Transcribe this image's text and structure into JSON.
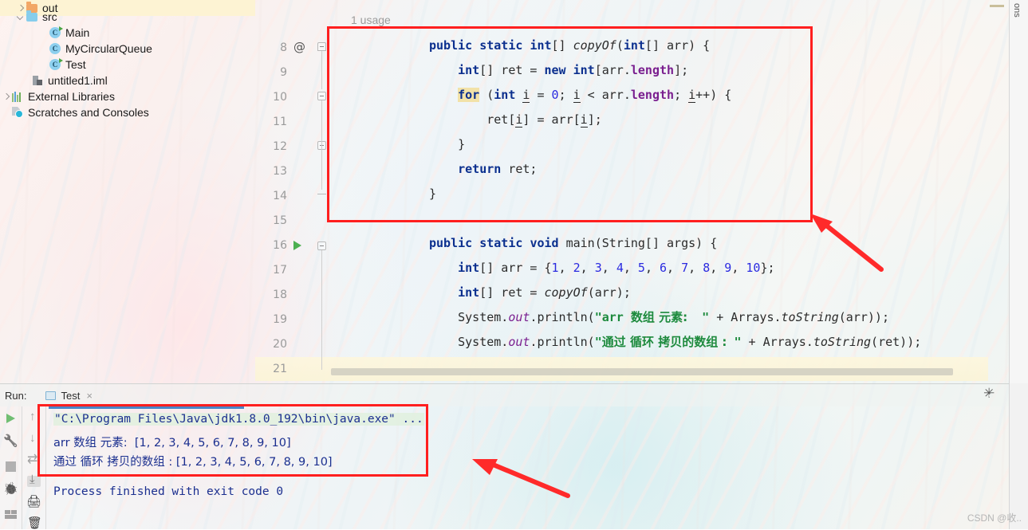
{
  "app": {
    "ide": "IntelliJ IDEA",
    "accent_red": "#ff1f1f",
    "watermark": "CSDN @收.."
  },
  "project_tree": {
    "items": [
      {
        "label": "out",
        "icon": "folder-orange-icon",
        "indent": 38,
        "arrow": "right",
        "selected": true
      },
      {
        "label": "src",
        "icon": "folder-blue-icon",
        "indent": 38,
        "arrow": "down",
        "selected": false
      },
      {
        "label": "Main",
        "icon": "class-runnable-icon",
        "indent": 62,
        "arrow": "none",
        "selected": false
      },
      {
        "label": "MyCircularQueue",
        "icon": "class-icon",
        "indent": 62,
        "arrow": "none",
        "selected": false
      },
      {
        "label": "Test",
        "icon": "class-runnable-icon",
        "indent": 62,
        "arrow": "none",
        "selected": false
      },
      {
        "label": "untitled1.iml",
        "icon": "iml-file-icon",
        "indent": 38,
        "arrow": "none",
        "selected": false
      },
      {
        "label": "External Libraries",
        "icon": "libraries-icon",
        "indent": 16,
        "arrow": "right",
        "selected": false
      },
      {
        "label": "Scratches and Consoles",
        "icon": "scratches-icon",
        "indent": 16,
        "arrow": "none",
        "selected": false
      }
    ]
  },
  "editor": {
    "usage_hint": "1 usage",
    "line_numbers": [
      "8",
      "9",
      "10",
      "11",
      "12",
      "13",
      "14",
      "15",
      "16",
      "17",
      "18",
      "19",
      "20",
      "21"
    ],
    "annotation_marker": "@",
    "current_line": "21",
    "code_lines": [
      {
        "n": "8",
        "text": "public static int[] copyOf(int[] arr) {"
      },
      {
        "n": "9",
        "text": "    int[] ret = new int[arr.length];"
      },
      {
        "n": "10",
        "text": "    for (int i = 0; i < arr.length; i++) {"
      },
      {
        "n": "11",
        "text": "        ret[i] = arr[i];"
      },
      {
        "n": "12",
        "text": "    }"
      },
      {
        "n": "13",
        "text": "    return ret;"
      },
      {
        "n": "14",
        "text": "}"
      },
      {
        "n": "15",
        "text": ""
      },
      {
        "n": "16",
        "text": "public static void main(String[] args) {"
      },
      {
        "n": "17",
        "text": "    int[] arr = {1, 2, 3, 4, 5, 6, 7, 8, 9, 10};"
      },
      {
        "n": "18",
        "text": "    int[] ret = copyOf(arr);"
      },
      {
        "n": "19",
        "text": "    System.out.println(\"arr 数组 元素:  \" + Arrays.toString(arr));"
      },
      {
        "n": "20",
        "text": "    System.out.println(\"通过 循环 拷贝的数组 : \" + Arrays.toString(ret));"
      },
      {
        "n": "21",
        "text": ""
      }
    ]
  },
  "right_strip": {
    "vertical_label": "ons"
  },
  "run_panel": {
    "run_label": "Run:",
    "tab_name": "Test",
    "tab_close": "×",
    "side_icons_1": [
      "run-play-icon",
      "wrench-icon",
      "stop-icon",
      "debug-icon",
      "layout-icon"
    ],
    "side_icons_2": [
      "scroll-up-icon",
      "scroll-down-icon",
      "soft-wrap-icon",
      "scroll-to-end-icon",
      "print-icon",
      "clear-all-icon"
    ],
    "header_icons": [
      "gear-icon",
      "minimize-icon"
    ],
    "console_lines": [
      {
        "text": "\"C:\\Program Files\\Java\\jdk1.8.0_192\\bin\\java.exe\" ...",
        "style": "command"
      },
      {
        "text": "arr 数组 元素:  [1, 2, 3, 4, 5, 6, 7, 8, 9, 10]",
        "style": "output"
      },
      {
        "text": "通过 循环 拷贝的数组 : [1, 2, 3, 4, 5, 6, 7, 8, 9, 10]",
        "style": "output"
      },
      {
        "text": "",
        "style": "output"
      },
      {
        "text": "Process finished with exit code 0",
        "style": "output"
      }
    ]
  },
  "annotations": {
    "box_code_label": "highlighted-copyOf-method",
    "box_console_label": "highlighted-console-output",
    "arrow_1_label": "arrow-pointing-to-code-box",
    "arrow_2_label": "arrow-pointing-to-console-box"
  }
}
